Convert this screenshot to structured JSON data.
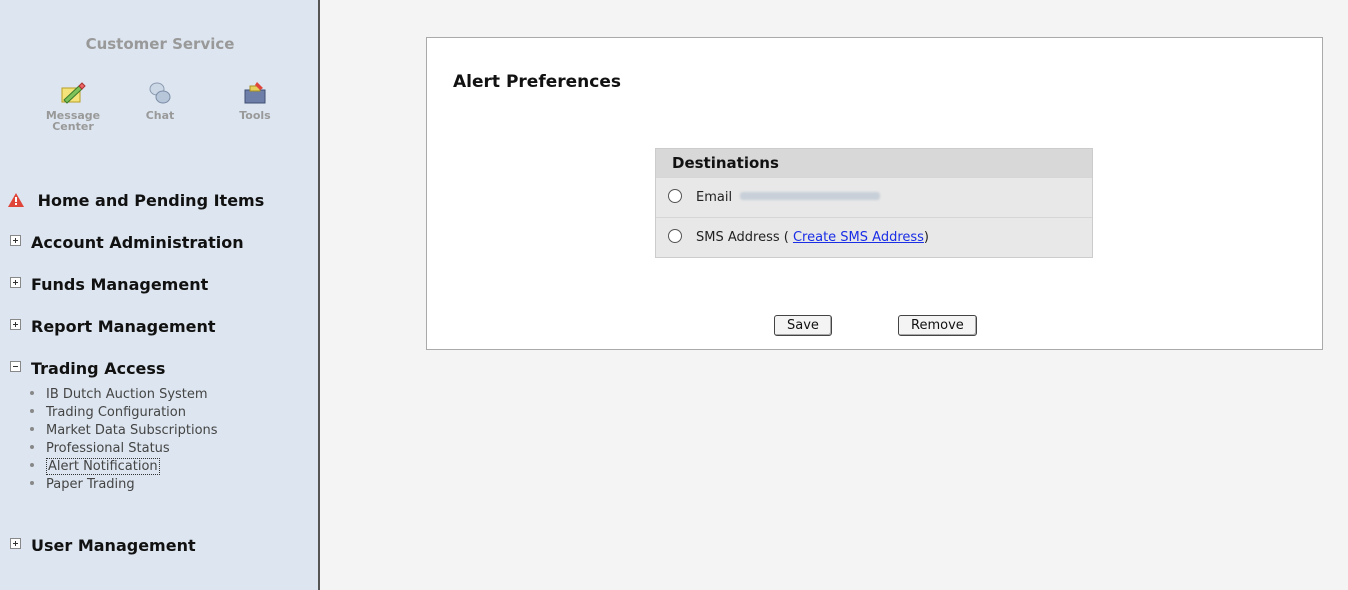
{
  "sidebar": {
    "title": "Customer Service",
    "tools": [
      {
        "label": "Message Center",
        "icon": "message-center-icon"
      },
      {
        "label": "Chat",
        "icon": "chat-icon"
      },
      {
        "label": "Tools",
        "icon": "tools-icon"
      }
    ],
    "nav": {
      "home": "Home and Pending Items",
      "account_admin": "Account Administration",
      "funds": "Funds Management",
      "report": "Report Management",
      "trading": "Trading Access",
      "user": "User Management"
    },
    "trading_subitems": [
      "IB Dutch Auction System",
      "Trading Configuration",
      "Market Data Subscriptions",
      "Professional Status",
      "Alert Notification",
      "Paper Trading"
    ],
    "selected_subitem": "Alert Notification"
  },
  "main": {
    "title": "Alert Preferences",
    "destinations": {
      "header": "Destinations",
      "email_label": "Email",
      "sms_prefix": "SMS Address ( ",
      "sms_link": "Create SMS Address",
      "sms_suffix": ")"
    },
    "buttons": {
      "save": "Save",
      "remove": "Remove"
    }
  },
  "colors": {
    "sidebar_bg": "#dde6f0",
    "link": "#1a2ee6",
    "warning": "#e0453a"
  }
}
